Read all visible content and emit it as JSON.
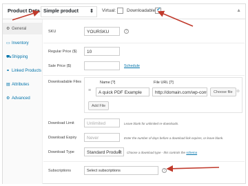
{
  "header": {
    "title": "Product Data",
    "dash": "—",
    "product_type": "Simple product",
    "product_type_caret": "⇕",
    "virtual_label": "Virtual:",
    "downloadable_label": "Downloadable:",
    "virtual_checked": false,
    "downloadable_checked": true
  },
  "sidebar": {
    "items": [
      {
        "icon": "⚙",
        "label": "General",
        "active": true
      },
      {
        "icon": "▭",
        "label": "Inventory",
        "active": false
      },
      {
        "icon": "⛟",
        "label": "Shipping",
        "active": false
      },
      {
        "icon": "⚭",
        "label": "Linked Products",
        "active": false
      },
      {
        "icon": "▤",
        "label": "Attributes",
        "active": false
      },
      {
        "icon": "⚙",
        "label": "Advanced",
        "active": false
      }
    ]
  },
  "fields": {
    "sku_label": "SKU",
    "sku_value": "YOURSKU",
    "regular_price_label": "Regular Price ($)",
    "regular_price_value": "10",
    "sale_price_label": "Sale Price ($)",
    "schedule_link": "Schedule",
    "downloadable_files_label": "Downloadable Files",
    "files_col_name": "Name [?]",
    "files_col_url": "File URL [?]",
    "file_name_value": "A quick PDF Example",
    "file_url_value": "http://domain.com/wp-content/",
    "choose_file_button": "Choose file",
    "add_file_button": "Add File",
    "download_limit_label": "Download Limit",
    "download_limit_placeholder": "Unlimited",
    "download_limit_note": "Leave blank for unlimited re-downloads.",
    "download_expiry_label": "Download Expiry",
    "download_expiry_placeholder": "Never",
    "download_expiry_note": "Enter the number of days before a download link expires, or leave blank.",
    "download_type_label": "Download Type",
    "download_type_value": "Standard Product",
    "download_type_caret": "⇕",
    "download_type_note": "Choose a download type - this controls the",
    "download_type_note_link": "schema",
    "subscriptions_label": "Subscriptions",
    "subscriptions_value": "Select subscriptions"
  },
  "colors": {
    "arrow": "#c0392b",
    "link": "#0073aa"
  }
}
